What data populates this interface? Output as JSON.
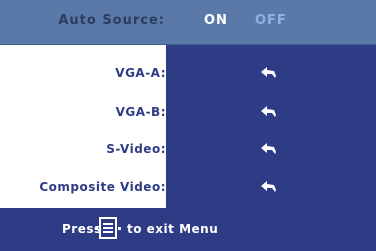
{
  "auto_source": {
    "label": "Auto Source:",
    "on_label": "ON",
    "off_label": "OFF",
    "selected": "ON"
  },
  "sources": [
    {
      "label": "VGA-A:",
      "icon": "enter-icon"
    },
    {
      "label": "VGA-B:",
      "icon": "enter-icon"
    },
    {
      "label": "S-Video:",
      "icon": "enter-icon"
    },
    {
      "label": "Composite Video:",
      "icon": "enter-icon"
    }
  ],
  "footer": {
    "press_label": "Press",
    "menu_key_icon": "menu-key-icon",
    "exit_label": "to exit Menu"
  },
  "colors": {
    "top_bar": "#5b79a8",
    "panel_dark": "#2e3c86",
    "text_dark": "#2e3c86",
    "off_text": "#8fb2e6"
  }
}
